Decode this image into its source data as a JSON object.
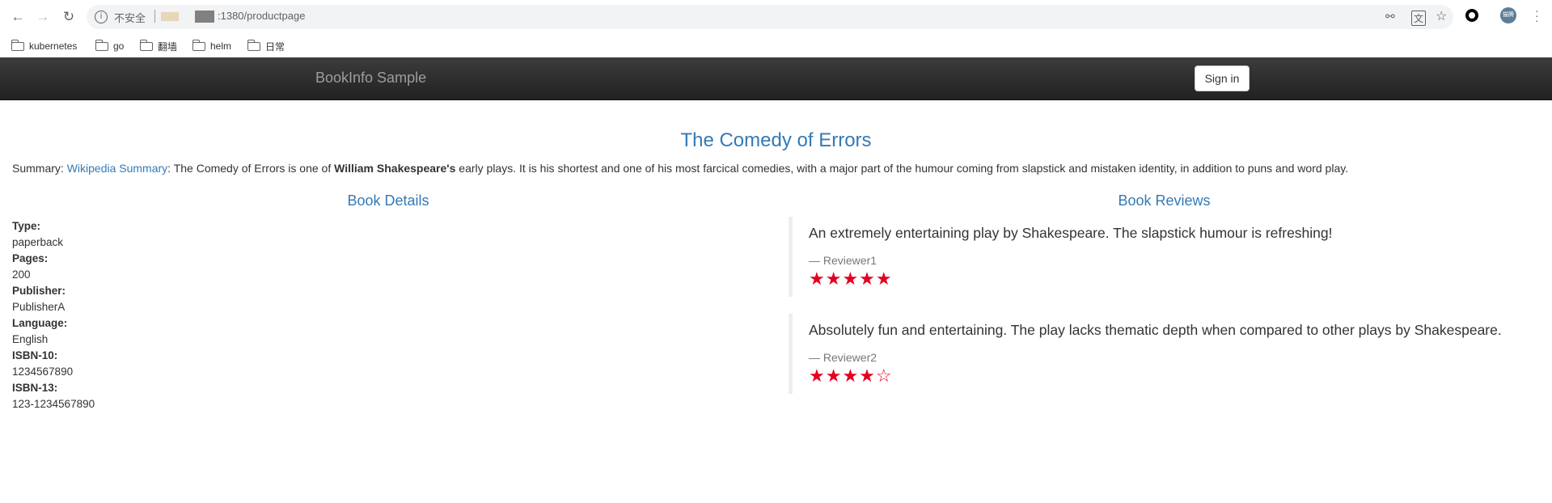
{
  "browser": {
    "insecure_label": "不安全",
    "url_dim": "",
    "url_visible": ":1380/productpage",
    "bookmarks": [
      "kubernetes",
      "go",
      "翻墙",
      "helm",
      "日常"
    ],
    "avatar_label": "猫腾"
  },
  "app": {
    "brand": "BookInfo Sample",
    "sign_in_label": "Sign in"
  },
  "product": {
    "title": "The Comedy of Errors",
    "summary_prefix": "Summary: ",
    "summary_link": "Wikipedia Summary",
    "summary_mid": ": The Comedy of Errors is one of ",
    "summary_bold": "William Shakespeare's",
    "summary_rest": " early plays. It is his shortest and one of his most farcical comedies, with a major part of the humour coming from slapstick and mistaken identity, in addition to puns and word play."
  },
  "details": {
    "heading": "Book Details",
    "type_label": "Type:",
    "type": "paperback",
    "pages_label": "Pages:",
    "pages": "200",
    "publisher_label": "Publisher:",
    "publisher": "PublisherA",
    "language_label": "Language:",
    "language": "English",
    "isbn10_label": "ISBN-10:",
    "isbn10": "1234567890",
    "isbn13_label": "ISBN-13:",
    "isbn13": "123-1234567890"
  },
  "reviews": {
    "heading": "Book Reviews",
    "items": [
      {
        "text": "An extremely entertaining play by Shakespeare. The slapstick humour is refreshing!",
        "reviewer": "— Reviewer1",
        "stars": "★★★★★",
        "rating": 5
      },
      {
        "text": "Absolutely fun and entertaining. The play lacks thematic depth when compared to other plays by Shakespeare.",
        "reviewer": "— Reviewer2",
        "stars": "★★★★☆",
        "rating": 4
      }
    ],
    "star_color": "#e6001f"
  },
  "colors": {
    "link": "#337ab7",
    "navbar": "#222222"
  }
}
